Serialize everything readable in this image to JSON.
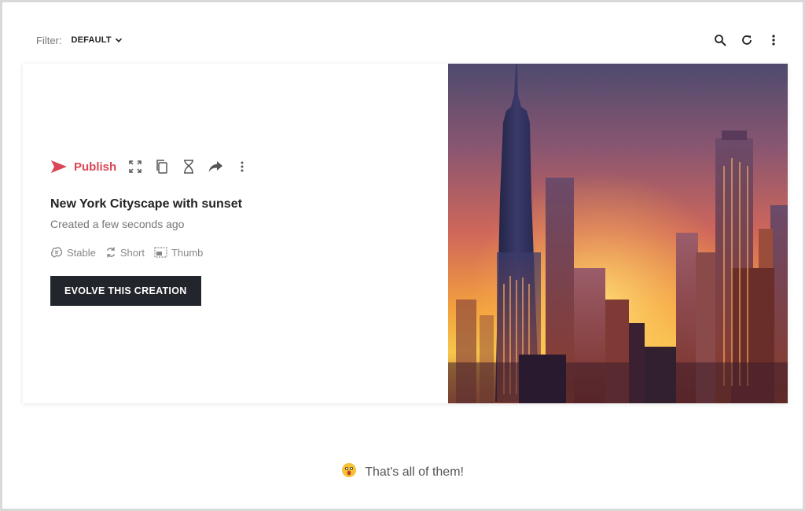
{
  "filter": {
    "label": "Filter:",
    "value": "DEFAULT"
  },
  "toolbar_icons": [
    "search-icon",
    "refresh-icon",
    "more-vertical-icon"
  ],
  "card": {
    "publish_label": "Publish",
    "action_icons": [
      "expand-icon",
      "copy-icon",
      "hourglass-icon",
      "share-icon",
      "more-vertical-icon"
    ],
    "title": "New York Cityscape with sunset",
    "created": "Created a few seconds ago",
    "meta": {
      "model": "Stable",
      "length": "Short",
      "thumb": "Thumb"
    },
    "evolve_label": "EVOLVE THIS CREATION"
  },
  "footer": {
    "message": "That's all of them!"
  },
  "colors": {
    "accent": "#d94655",
    "button_dark": "#22262c"
  }
}
